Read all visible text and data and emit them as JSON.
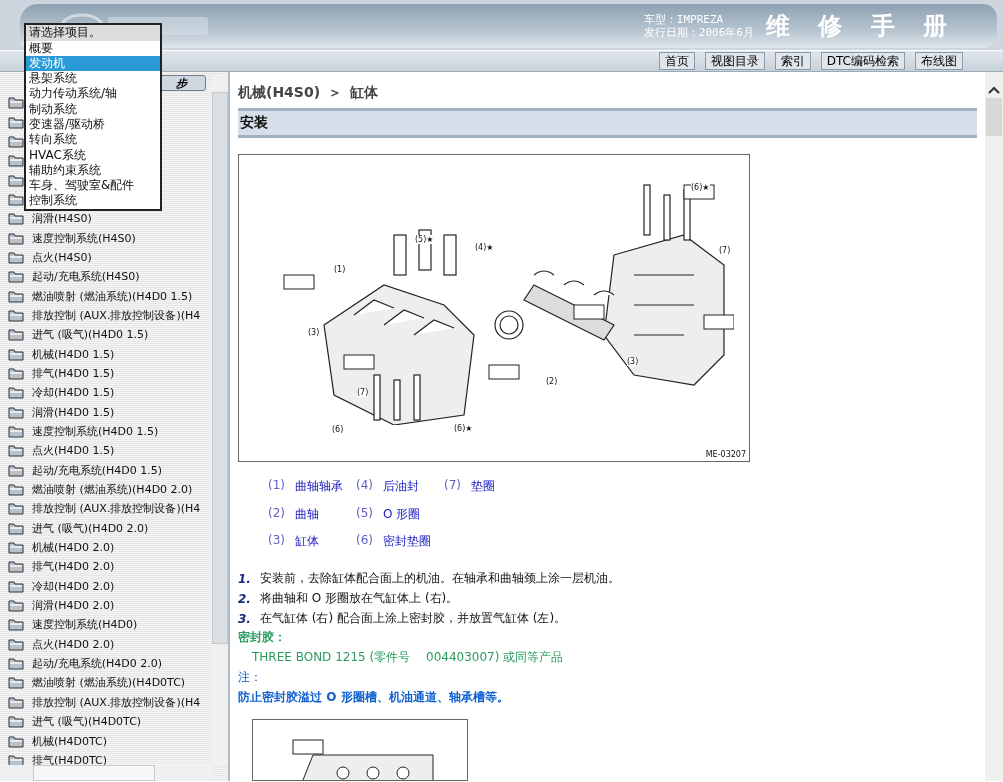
{
  "header": {
    "model": "车型：IMPREZA",
    "date": "发行日期：2006年6月",
    "title": "维 修 手 册"
  },
  "nav": [
    "首页",
    "视图目录",
    "索引",
    "DTC编码检索",
    "布线图"
  ],
  "sidebar": {
    "sync_button": "步",
    "items": [
      "润滑(H4S0)",
      "速度控制系统(H4S0)",
      "点火(H4S0)",
      "起动/充电系统(H4S0)",
      "燃油喷射 (燃油系统)(H4D0 1.5)",
      "排放控制 (AUX.排放控制设备)(H4",
      "进气 (吸气)(H4D0 1.5)",
      "机械(H4D0 1.5)",
      "排气(H4D0 1.5)",
      "冷却(H4D0 1.5)",
      "润滑(H4D0 1.5)",
      "速度控制系统(H4D0 1.5)",
      "点火(H4D0 1.5)",
      "起动/充电系统(H4D0 1.5)",
      "燃油喷射 (燃油系统)(H4D0 2.0)",
      "排放控制 (AUX.排放控制设备)(H4",
      "进气 (吸气)(H4D0 2.0)",
      "机械(H4D0 2.0)",
      "排气(H4D0 2.0)",
      "冷却(H4D0 2.0)",
      "润滑(H4D0 2.0)",
      "速度控制系统(H4D0)",
      "点火(H4D0 2.0)",
      "起动/充电系统(H4D0 2.0)",
      "燃油喷射 (燃油系统)(H4D0TC)",
      "排放控制 (AUX.排放控制设备)(H4",
      "进气 (吸气)(H4D0TC)",
      "机械(H4D0TC)",
      "排气(H4D0TC)"
    ]
  },
  "dropdown": {
    "prompt": "请选择项目。",
    "options": [
      {
        "label": "概要",
        "selected": false
      },
      {
        "label": "发动机",
        "selected": true
      },
      {
        "label": "悬架系统",
        "selected": false
      },
      {
        "label": "动力传动系统/轴",
        "selected": false
      },
      {
        "label": "制动系统",
        "selected": false
      },
      {
        "label": "变速器/驱动桥",
        "selected": false
      },
      {
        "label": "转向系统",
        "selected": false
      },
      {
        "label": "HVAC系统",
        "selected": false
      },
      {
        "label": "辅助约束系统",
        "selected": false
      },
      {
        "label": "车身、驾驶室&配件",
        "selected": false
      },
      {
        "label": "控制系统",
        "selected": false
      }
    ]
  },
  "content": {
    "breadcrumb": [
      "机械(H4S0)",
      "＞",
      "缸体"
    ],
    "section": "安装",
    "figure": {
      "code": "ME-03207",
      "callouts": [
        "(1)",
        "(2)",
        "(3)",
        "(3)",
        "(4)★",
        "(5)★",
        "(6)★",
        "(6)★",
        "(6)",
        "(7)",
        "(7)"
      ]
    },
    "legend": [
      {
        "num": "(1)",
        "label": "曲轴轴承"
      },
      {
        "num": "(4)",
        "label": "后油封"
      },
      {
        "num": "(7)",
        "label": "垫圈"
      },
      {
        "num": "(2)",
        "label": "曲轴"
      },
      {
        "num": "(5)",
        "label": "O 形圈"
      },
      {
        "num": "(3)",
        "label": "缸体"
      },
      {
        "num": "(6)",
        "label": "密封垫圈"
      }
    ],
    "steps": [
      {
        "num": "1.",
        "text": "安装前，去除缸体配合面上的机油。在轴承和曲轴颈上涂一层机油。"
      },
      {
        "num": "2.",
        "text": "将曲轴和 O 形圈放在气缸体上 (右)。"
      },
      {
        "num": "3.",
        "text": "在气缸体 (右) 配合面上涂上密封胶，并放置气缸体 (左)。"
      }
    ],
    "sealant_label": "密封胶：",
    "sealant": "THREE BOND 1215 (零件号　 004403007) 或同等产品",
    "note_label": "注：",
    "note": "防止密封胶溢过 O 形圈槽、机油通道、轴承槽等。"
  }
}
